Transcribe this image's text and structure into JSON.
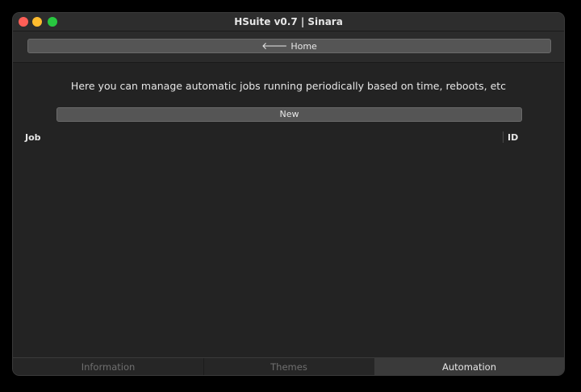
{
  "window": {
    "title": "HSuite v0.7 | Sinara"
  },
  "toolbar": {
    "home_label": "Home",
    "home_icon": "arrow-left-icon"
  },
  "main": {
    "description": "Here you can manage automatic jobs running periodically based on time, reboots, etc",
    "new_label": "New",
    "table": {
      "columns": [
        "Job",
        "ID"
      ],
      "rows": []
    }
  },
  "tabs": [
    {
      "label": "Information",
      "active": false
    },
    {
      "label": "Themes",
      "active": false
    },
    {
      "label": "Automation",
      "active": true
    }
  ]
}
